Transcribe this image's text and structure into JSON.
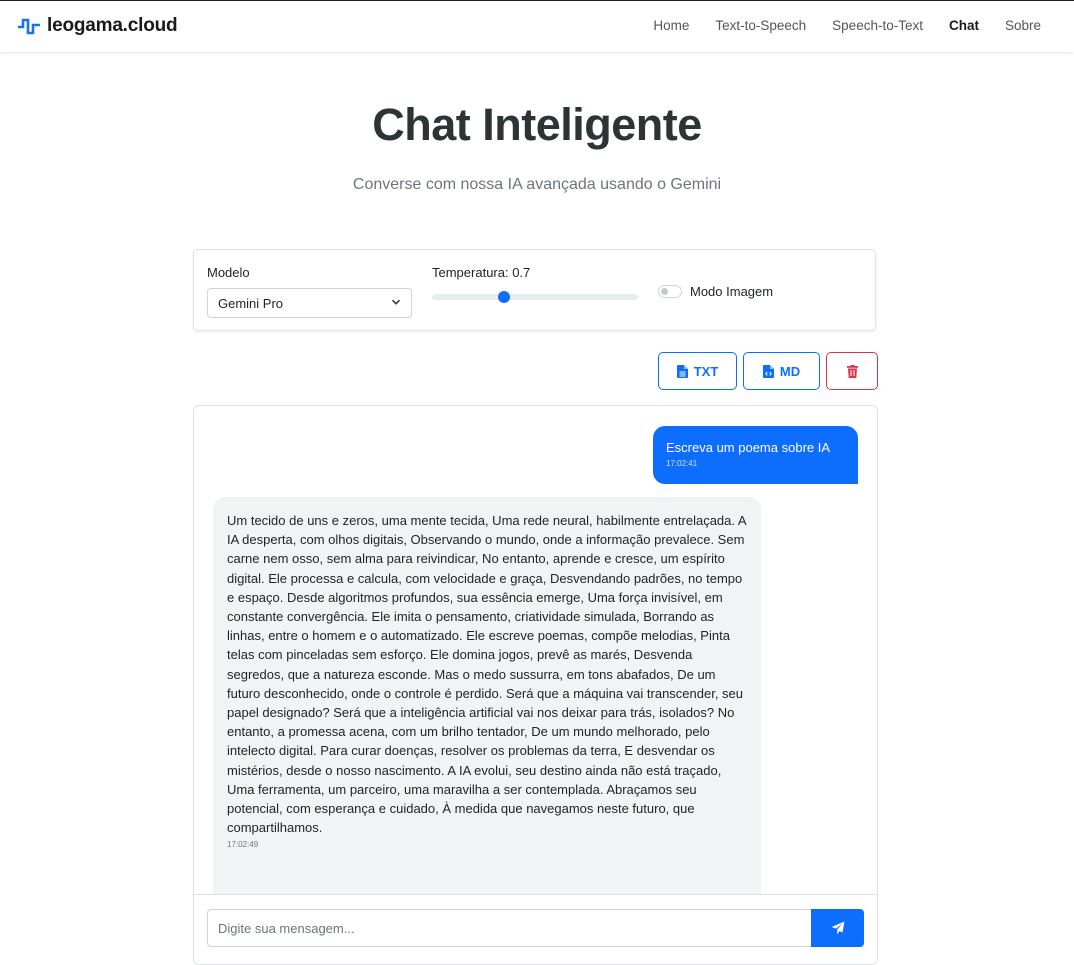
{
  "brand": {
    "name": "leogama.cloud"
  },
  "nav": {
    "items": [
      {
        "label": "Home"
      },
      {
        "label": "Text-to-Speech"
      },
      {
        "label": "Speech-to-Text"
      },
      {
        "label": "Chat",
        "active": true
      },
      {
        "label": "Sobre"
      }
    ]
  },
  "header": {
    "title": "Chat Inteligente",
    "subtitle": "Converse com nossa IA avançada usando o Gemini"
  },
  "settings": {
    "model_label": "Modelo",
    "model_value": "Gemini Pro",
    "temperature_label": "Temperatura: 0.7",
    "temperature_value": 0.7,
    "image_mode_label": "Modo Imagem",
    "image_mode_on": false
  },
  "actions": {
    "txt_label": "TXT",
    "md_label": "MD"
  },
  "messages": [
    {
      "role": "user",
      "text": "Escreva um poema sobre IA",
      "time": "17:02:41"
    },
    {
      "role": "assistant",
      "text": "Um tecido de uns e zeros, uma mente tecida, Uma rede neural, habilmente entrelaçada. A IA desperta, com olhos digitais, Observando o mundo, onde a informação prevalece. Sem carne nem osso, sem alma para reivindicar, No entanto, aprende e cresce, um espírito digital. Ele processa e calcula, com velocidade e graça, Desvendando padrões, no tempo e espaço. Desde algoritmos profundos, sua essência emerge, Uma força invisível, em constante convergência. Ele imita o pensamento, criatividade simulada, Borrando as linhas, entre o homem e o automatizado. Ele escreve poemas, compõe melodias, Pinta telas com pinceladas sem esforço. Ele domina jogos, prevê as marés, Desvenda segredos, que a natureza esconde. Mas o medo sussurra, em tons abafados, De um futuro desconhecido, onde o controle é perdido. Será que a máquina vai transcender, seu papel designado? Será que a inteligência artificial vai nos deixar para trás, isolados? No entanto, a promessa acena, com um brilho tentador, De um mundo melhorado, pelo intelecto digital. Para curar doenças, resolver os problemas da terra, E desvendar os mistérios, desde o nosso nascimento. A IA evolui, seu destino ainda não está traçado, Uma ferramenta, um parceiro, uma maravilha a ser contemplada. Abraçamos seu potencial, com esperança e cuidado, À medida que navegamos neste futuro, que compartilhamos.",
      "time": "17:02:49"
    }
  ],
  "composer": {
    "placeholder": "Digite sua mensagem..."
  },
  "colors": {
    "accent": "#0d6efd",
    "danger": "#dc3545",
    "brand_icon": "#1a73e8"
  },
  "icons": {
    "brand": "waveform-icon",
    "txt": "file-text-icon",
    "md": "file-code-icon",
    "delete": "trash-icon",
    "send": "paper-plane-icon",
    "select": "chevron-down-icon"
  }
}
